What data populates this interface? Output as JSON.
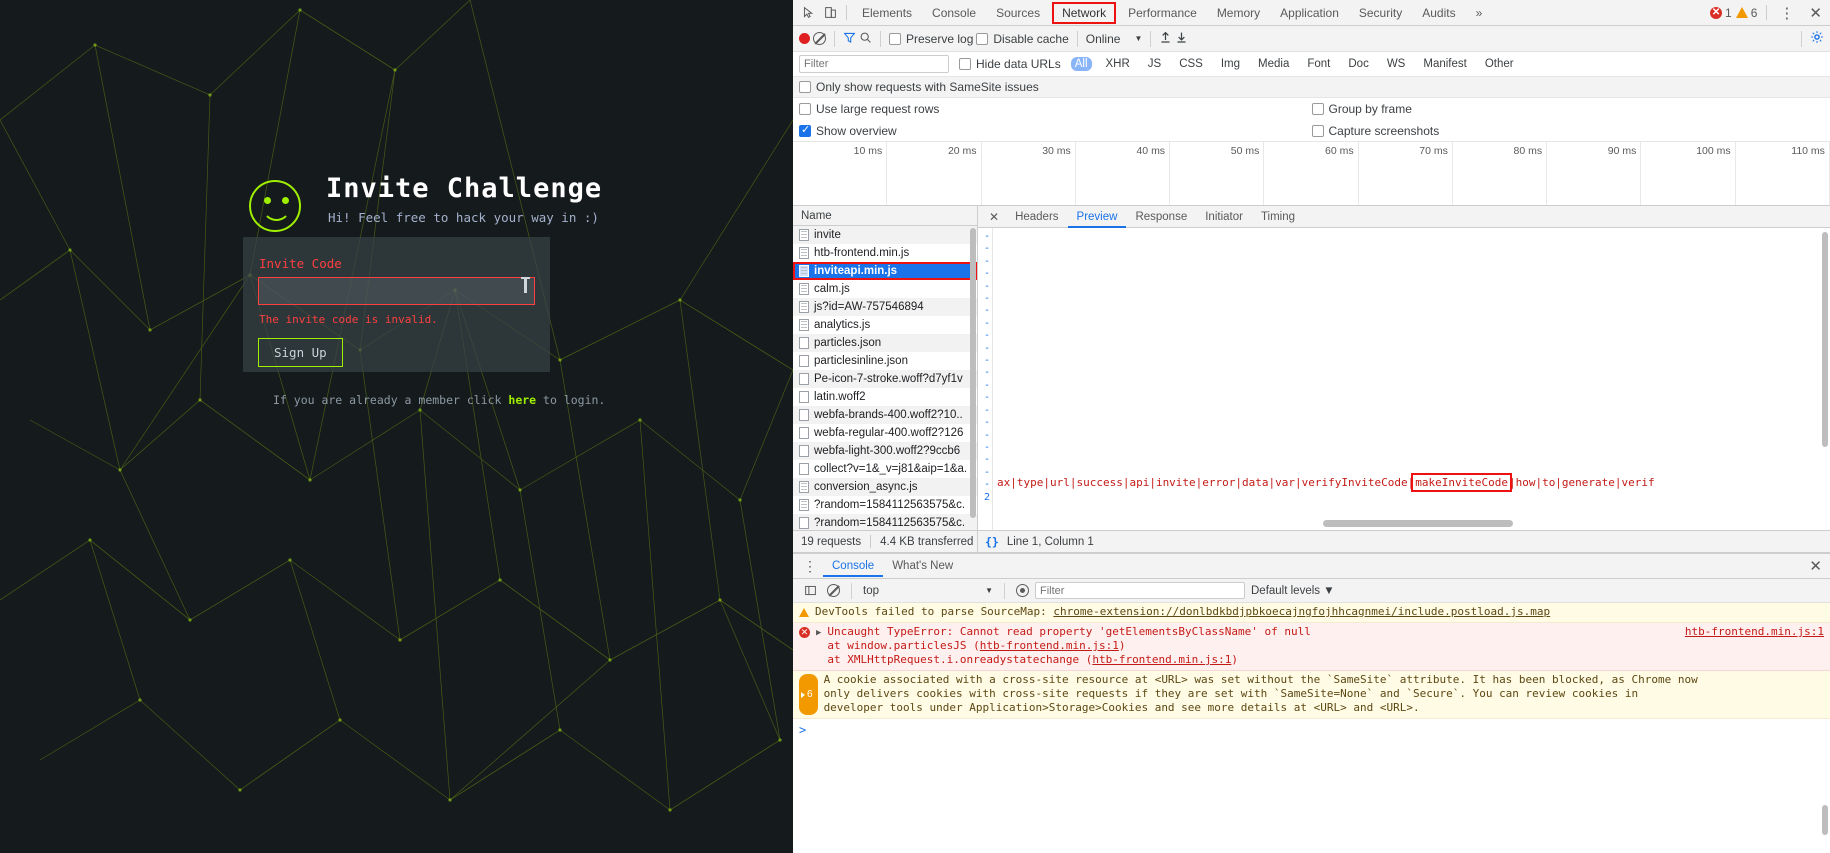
{
  "page": {
    "title": "Invite Challenge",
    "subtitle": "Hi! Feel free to hack your way in :)",
    "invite_label": "Invite Code",
    "invite_value": "",
    "invite_placeholder": "",
    "error_text": "The invite code is invalid.",
    "signup_label": "Sign Up",
    "login_prefix": "If you are already a member click ",
    "login_link": "here",
    "login_suffix": " to login."
  },
  "devtools": {
    "tabs": [
      {
        "label": "Elements",
        "active": false
      },
      {
        "label": "Console",
        "active": false
      },
      {
        "label": "Sources",
        "active": false
      },
      {
        "label": "Network",
        "active": true
      },
      {
        "label": "Performance",
        "active": false
      },
      {
        "label": "Memory",
        "active": false
      },
      {
        "label": "Application",
        "active": false
      },
      {
        "label": "Security",
        "active": false
      },
      {
        "label": "Audits",
        "active": false
      }
    ],
    "more_tabs": "»",
    "error_count": "1",
    "warning_count": "6",
    "kebab": "⋮",
    "close": "✕"
  },
  "network_toolbar": {
    "preserve_log": "Preserve log",
    "disable_cache": "Disable cache",
    "throttling": "Online",
    "throttling_caret": "▼"
  },
  "filter_row": {
    "filter_placeholder": "Filter",
    "filter_value": "",
    "hide_data_urls": "Hide data URLs",
    "types": [
      "All",
      "XHR",
      "JS",
      "CSS",
      "Img",
      "Media",
      "Font",
      "Doc",
      "WS",
      "Manifest",
      "Other"
    ],
    "selected_type": "All"
  },
  "options": {
    "samesite_only": "Only show requests with SameSite issues",
    "use_large_rows": "Use large request rows",
    "group_by_frame": "Group by frame",
    "show_overview": "Show overview",
    "capture_screenshots": "Capture screenshots"
  },
  "overview": {
    "ticks": [
      "10 ms",
      "20 ms",
      "30 ms",
      "40 ms",
      "50 ms",
      "60 ms",
      "70 ms",
      "80 ms",
      "90 ms",
      "100 ms",
      "110 ms"
    ]
  },
  "requests": {
    "column_name": "Name",
    "rows": [
      {
        "name": "invite",
        "icon": "document-icon",
        "selected": false
      },
      {
        "name": "htb-frontend.min.js",
        "icon": "document-icon",
        "selected": false
      },
      {
        "name": "inviteapi.min.js",
        "icon": "document-icon",
        "selected": true
      },
      {
        "name": "calm.js",
        "icon": "document-icon",
        "selected": false
      },
      {
        "name": "js?id=AW-757546894",
        "icon": "document-icon",
        "selected": false
      },
      {
        "name": "analytics.js",
        "icon": "document-icon",
        "selected": false
      },
      {
        "name": "particles.json",
        "icon": "file-icon",
        "selected": false
      },
      {
        "name": "particlesinline.json",
        "icon": "file-icon",
        "selected": false
      },
      {
        "name": "Pe-icon-7-stroke.woff?d7yf1v",
        "icon": "file-icon",
        "selected": false
      },
      {
        "name": "latin.woff2",
        "icon": "file-icon",
        "selected": false
      },
      {
        "name": "webfa-brands-400.woff2?10..",
        "icon": "file-icon",
        "selected": false
      },
      {
        "name": "webfa-regular-400.woff2?126",
        "icon": "file-icon",
        "selected": false
      },
      {
        "name": "webfa-light-300.woff2?9ccb6",
        "icon": "file-icon",
        "selected": false
      },
      {
        "name": "collect?v=1&_v=j81&aip=1&a.",
        "icon": "file-icon",
        "selected": false
      },
      {
        "name": "conversion_async.js",
        "icon": "document-icon",
        "selected": false
      },
      {
        "name": "?random=1584112563575&c.",
        "icon": "document-icon",
        "selected": false
      },
      {
        "name": "?random=1584112563575&c.",
        "icon": "file-icon",
        "selected": false
      }
    ],
    "footer_requests": "19 requests",
    "footer_transferred": "4.4 KB transferred"
  },
  "detail": {
    "tabs": [
      {
        "label": "Headers",
        "active": false
      },
      {
        "label": "Preview",
        "active": true
      },
      {
        "label": "Response",
        "active": false
      },
      {
        "label": "Initiator",
        "active": false
      },
      {
        "label": "Timing",
        "active": false
      }
    ],
    "close": "✕",
    "code_prefix": "ax|type|url|success|api|invite|error|data|var|verifyInviteCode|",
    "code_highlight": "makeInviteCode",
    "code_suffix": "|how|to|generate|verif",
    "gutter_last": "2",
    "footer_position": "Line 1, Column 1",
    "footer_format": "{}"
  },
  "console": {
    "tabs": [
      {
        "label": "Console",
        "active": true
      },
      {
        "label": "What's New",
        "active": false
      }
    ],
    "context": "top",
    "context_caret": "▼",
    "filter_placeholder": "Filter",
    "filter_value": "",
    "levels": "Default levels ▼",
    "close": "✕",
    "prompt": ">",
    "messages": [
      {
        "type": "warn",
        "icon": "warning-icon",
        "text": "DevTools failed to parse SourceMap: ",
        "link": "chrome-extension://donlbdkbdjpbkoecajngfojhhcagnmei/include.postload.js.map",
        "source": ""
      },
      {
        "type": "err",
        "icon": "error-icon",
        "text": "Uncaught TypeError: Cannot read property 'getElementsByClassName' of null",
        "line2_pre": "    at window.particlesJS (",
        "line2_link": "htb-frontend.min.js:1",
        "line2_post": ")",
        "line3_pre": "    at XMLHttpRequest.i.onreadystatechange (",
        "line3_link": "htb-frontend.min.js:1",
        "line3_post": ")",
        "source": "htb-frontend.min.js:1"
      },
      {
        "type": "info",
        "icon": "info-group-icon",
        "count": "6",
        "text": "A cookie associated with a cross-site resource at <URL> was set without the `SameSite` attribute. It has been blocked, as Chrome now only delivers cookies with cross-site requests if they are set with `SameSite=None` and `Secure`. You can review cookies in developer tools under Application>Storage>Cookies and see more details at <URL> and <URL>.",
        "source": ""
      }
    ]
  },
  "colors": {
    "accent_green": "#9fef00",
    "error_red": "#ff3e3e",
    "devtools_blue": "#1a73e8",
    "highlight_red": "#ee1111"
  }
}
